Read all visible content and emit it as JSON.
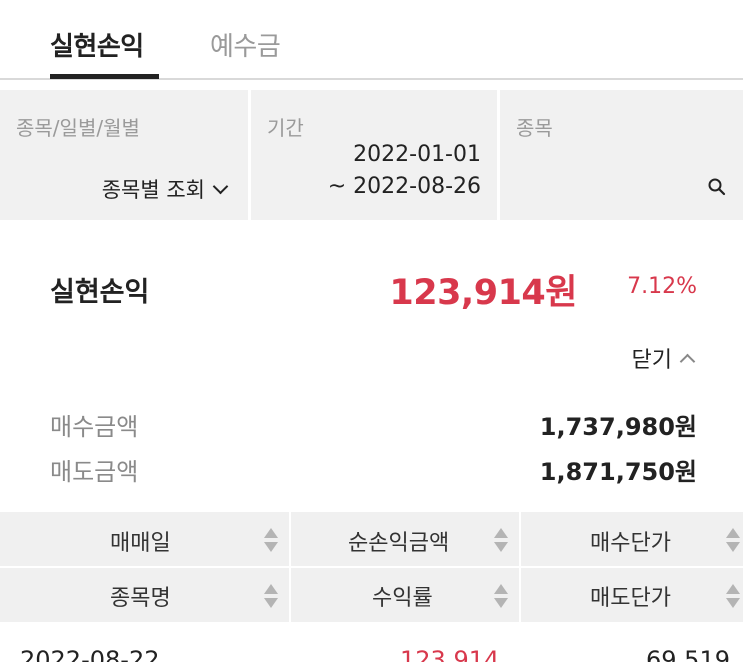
{
  "tabs": [
    {
      "label": "실현손익",
      "active": true
    },
    {
      "label": "예수금",
      "active": false
    }
  ],
  "filters": {
    "type": {
      "label": "종목/일별/월별",
      "value": "종목별 조회"
    },
    "period": {
      "label": "기간",
      "start": "2022-01-01",
      "end": "~ 2022-08-26"
    },
    "stock": {
      "label": "종목",
      "value": ""
    }
  },
  "summary": {
    "title": "실현손익",
    "amount": "123,914원",
    "rate": "7.12%",
    "toggle_label": "닫기",
    "details": [
      {
        "label": "매수금액",
        "value": "1,737,980원"
      },
      {
        "label": "매도금액",
        "value": "1,871,750원"
      }
    ]
  },
  "table": {
    "headers_row1": [
      "매매일",
      "순손익금액",
      "매수단가"
    ],
    "headers_row2": [
      "종목명",
      "수익률",
      "매도단가"
    ],
    "rows": [
      {
        "date": "2022-08-22",
        "profit": "123,914",
        "buy_price": "69,519"
      }
    ]
  },
  "colors": {
    "accent_red": "#d8384c",
    "panel_bg": "#f1f1f1",
    "muted_text": "#9a9a9a"
  },
  "icons": {
    "dropdown": "chevron-down-icon",
    "collapse": "chevron-up-icon",
    "search": "search-icon",
    "sort": "sort-icon"
  }
}
